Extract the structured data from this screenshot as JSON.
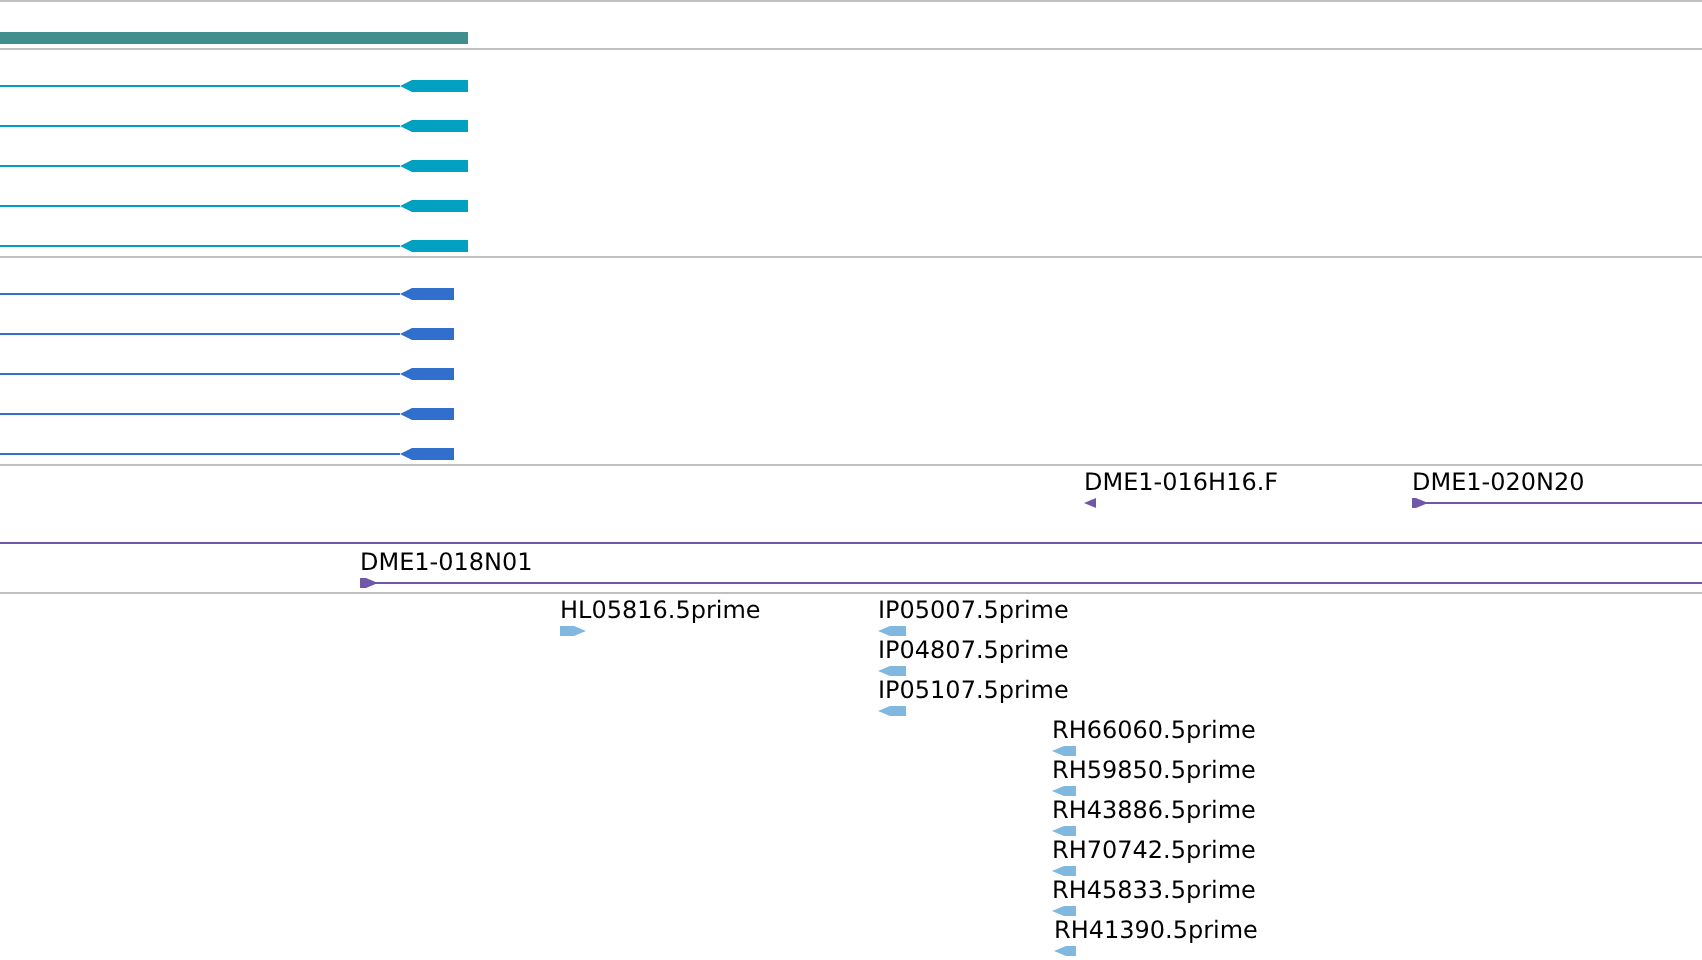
{
  "tracks": [
    {
      "color": "#3f8f8f",
      "rows": [
        [
          {
            "kind": "block"
          }
        ]
      ]
    },
    {
      "color": "#00a0c0",
      "rows": [
        [
          {
            "kind": "arrow",
            "reverse": true
          }
        ],
        [
          {
            "kind": "arrow",
            "reverse": true
          }
        ],
        [
          {
            "kind": "arrow",
            "reverse": true
          }
        ],
        [
          {
            "kind": "arrow",
            "reverse": true
          }
        ],
        [
          {
            "kind": "arrow",
            "reverse": true
          }
        ]
      ]
    },
    {
      "color": "#3070cc",
      "rows": [
        [
          {
            "kind": "arrow",
            "reverse": true
          }
        ],
        [
          {
            "kind": "arrow",
            "reverse": true
          }
        ],
        [
          {
            "kind": "arrow",
            "reverse": true
          }
        ],
        [
          {
            "kind": "arrow",
            "reverse": true
          }
        ],
        [
          {
            "kind": "arrow",
            "reverse": true
          }
        ]
      ]
    },
    {
      "color": "#7058a8",
      "rows": [
        [
          {
            "kind": "arrow",
            "reverse": true,
            "label": "DME1-016H16.F"
          },
          {
            "kind": "arrow",
            "reverse": false,
            "label": "DME1-020N20"
          }
        ],
        [
          {
            "kind": "line"
          }
        ],
        [
          {
            "kind": "arrow",
            "reverse": false,
            "label": "DME1-018N01"
          }
        ]
      ]
    },
    {
      "color": "#80b8e0",
      "rows": [
        [
          {
            "kind": "arrow",
            "reverse": false,
            "label": "HL05816.5prime"
          },
          {
            "kind": "arrow",
            "reverse": true,
            "label": "IP05007.5prime"
          }
        ],
        [
          {
            "kind": "arrow",
            "reverse": true,
            "label": "IP04807.5prime"
          }
        ],
        [
          {
            "kind": "arrow",
            "reverse": true,
            "label": "IP05107.5prime"
          }
        ],
        [
          {
            "kind": "arrow",
            "reverse": true,
            "label": "RH66060.5prime"
          }
        ],
        [
          {
            "kind": "arrow",
            "reverse": true,
            "label": "RH59850.5prime"
          }
        ],
        [
          {
            "kind": "arrow",
            "reverse": true,
            "label": "RH43886.5prime"
          }
        ],
        [
          {
            "kind": "arrow",
            "reverse": true,
            "label": "RH70742.5prime"
          }
        ],
        [
          {
            "kind": "arrow",
            "reverse": true,
            "label": "RH45833.5prime"
          }
        ],
        [
          {
            "kind": "arrow",
            "reverse": true,
            "label": "RH41390.5prime"
          }
        ]
      ]
    }
  ]
}
